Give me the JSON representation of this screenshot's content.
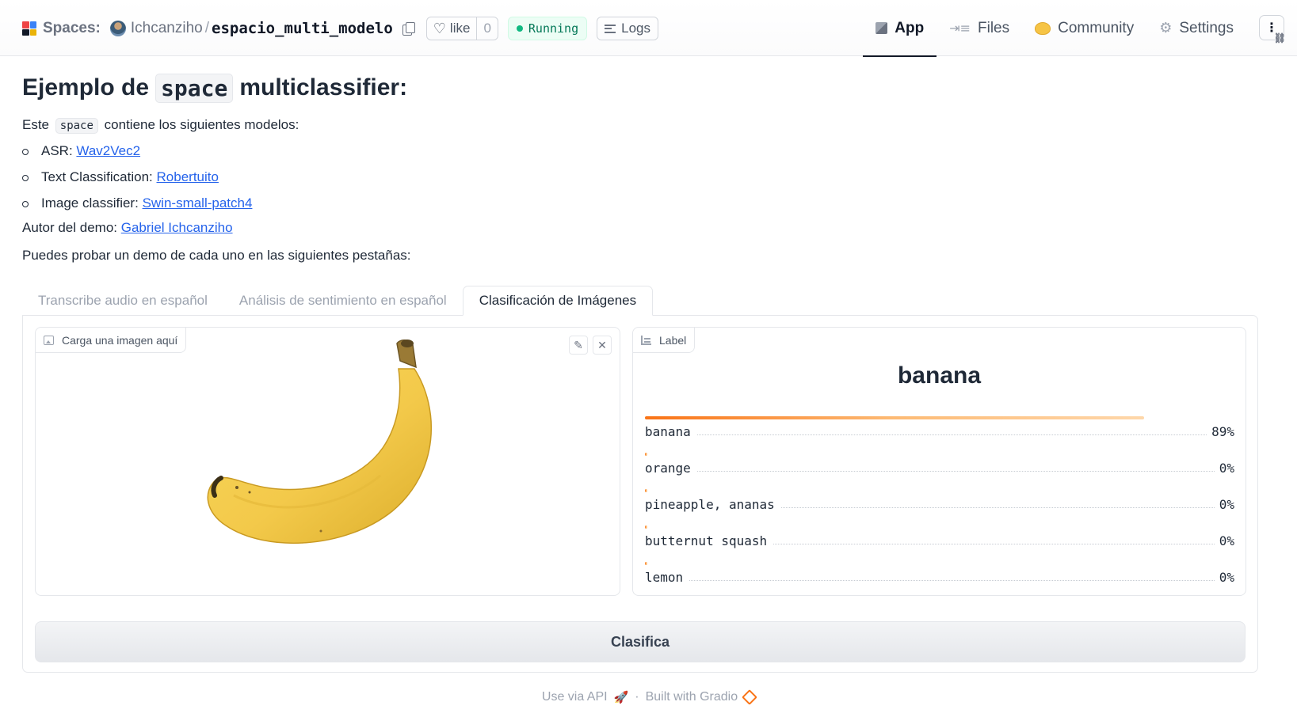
{
  "header": {
    "spaces_label": "Spaces:",
    "owner": "Ichcanziho",
    "repo": "espacio_multi_modelo",
    "like_label": "like",
    "like_count": "0",
    "status": "Running",
    "logs_label": "Logs",
    "nav": [
      {
        "label": "App",
        "icon": "cube-icon",
        "active": true
      },
      {
        "label": "Files",
        "icon": "files-icon"
      },
      {
        "label": "Community",
        "icon": "community-icon"
      },
      {
        "label": "Settings",
        "icon": "gear-icon"
      }
    ]
  },
  "intro": {
    "title_pre": "Ejemplo de",
    "title_code": "space",
    "title_post": "multiclassifier:",
    "desc_pre": "Este",
    "desc_code": "space",
    "desc_post": "contiene los siguientes modelos:",
    "models": [
      {
        "prefix": "ASR:",
        "link": "Wav2Vec2"
      },
      {
        "prefix": "Text Classification:",
        "link": "Robertuito"
      },
      {
        "prefix": "Image classifier:",
        "link": "Swin-small-patch4"
      }
    ],
    "author_prefix": "Autor del demo:",
    "author_link": "Gabriel Ichcanziho",
    "try_text": "Puedes probar un demo de cada uno en las siguientes pestañas:"
  },
  "tabs": [
    {
      "label": "Transcribe audio en español",
      "active": false
    },
    {
      "label": "Análisis de sentimiento en español",
      "active": false
    },
    {
      "label": "Clasificación de Imágenes",
      "active": true
    }
  ],
  "image_input": {
    "label": "Carga una imagen aquí"
  },
  "label_output": {
    "label": "Label",
    "predicted": "banana",
    "confidences": [
      {
        "name": "banana",
        "value": 0.89,
        "display": "89%"
      },
      {
        "name": "orange",
        "value": 0.0,
        "display": "0%"
      },
      {
        "name": "pineapple, ananas",
        "value": 0.0,
        "display": "0%"
      },
      {
        "name": "butternut squash",
        "value": 0.0,
        "display": "0%"
      },
      {
        "name": "lemon",
        "value": 0.0,
        "display": "0%"
      }
    ]
  },
  "submit_label": "Clasifica",
  "footer": {
    "api": "Use via API",
    "sep": "·",
    "built": "Built with Gradio"
  }
}
